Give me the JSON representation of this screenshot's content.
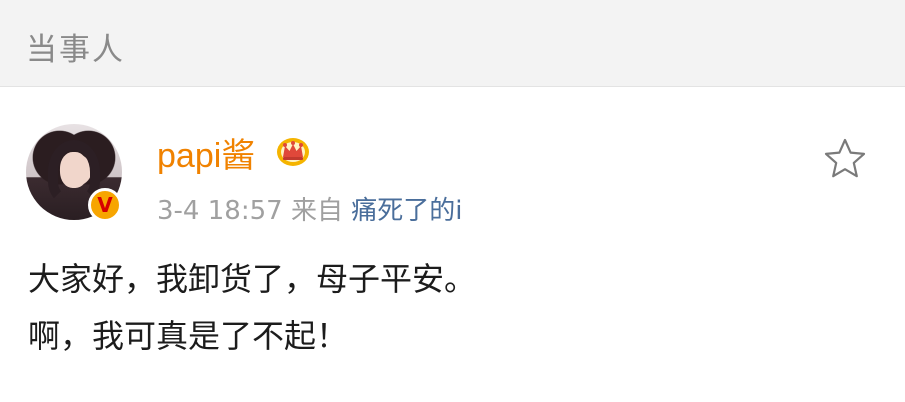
{
  "header": {
    "title": "当事人"
  },
  "post": {
    "author": {
      "name": "papi酱",
      "verified_badge": "V",
      "avatar_icon": "avatar",
      "crown_icon": "crown-icon"
    },
    "meta": {
      "time": "3-4 18:57",
      "from_label": "来自",
      "source": "痛死了的i"
    },
    "favorite_icon": "star-outline-icon",
    "text": {
      "line1": "大家好，我卸货了，母子平安。",
      "line2": "啊，我可真是了不起！"
    }
  },
  "colors": {
    "username": "#f08200",
    "source_link": "#4a6e9b",
    "meta_gray": "#a0a0a0",
    "header_bg": "#f3f3f3",
    "crown_gold": "#f5b400",
    "badge_orange": "#f7a500"
  }
}
